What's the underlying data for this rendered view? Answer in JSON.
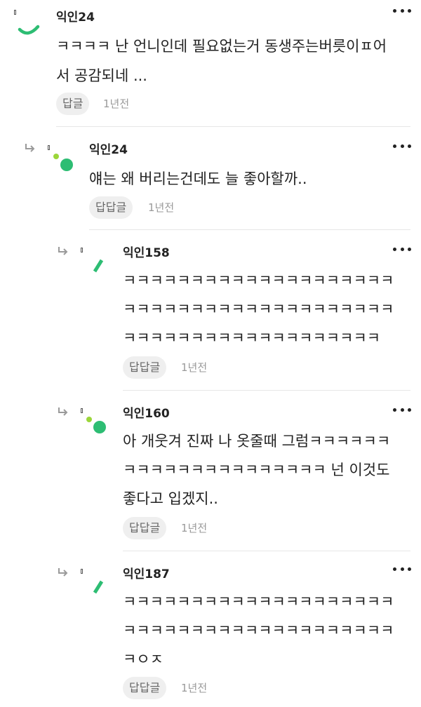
{
  "comments": [
    {
      "author": "익인24",
      "lines": [
        "ㅋㅋㅋㅋ 난 언니인데 필요없는거 동생주는버릇이ㅍ어",
        "서 공감되네 ..."
      ],
      "reply_label": "답글",
      "time": "1년전",
      "avatar_icon": "arc-avatar-icon"
    },
    {
      "author": "익인24",
      "lines": [
        "얘는 왜 버리는건데도 늘 좋아할까.."
      ],
      "reply_label": "답답글",
      "time": "1년전",
      "avatar_icon": "dots-avatar-icon"
    },
    {
      "author": "익인158",
      "lines": [
        "ㅋㅋㅋㅋㅋㅋㅋㅋㅋㅋㅋㅋㅋㅋㅋㅋㅋㅋㅋㅋ",
        "ㅋㅋㅋㅋㅋㅋㅋㅋㅋㅋㅋㅋㅋㅋㅋㅋㅋㅋㅋㅋ",
        "ㅋㅋㅋㅋㅋㅋㅋㅋㅋㅋㅋㅋㅋㅋㅋㅋㅋㅋㅋ"
      ],
      "reply_label": "답답글",
      "time": "1년전",
      "avatar_icon": "slash-avatar-icon"
    },
    {
      "author": "익인160",
      "lines": [
        "아 개웃겨 진짜 나 옷줄때 그럼ㅋㅋㅋㅋㅋㅋ",
        "ㅋㅋㅋㅋㅋㅋㅋㅋㅋㅋㅋㅋㅋㅋㅋ 넌 이것도",
        "좋다고 입겠지.."
      ],
      "reply_label": "답답글",
      "time": "1년전",
      "avatar_icon": "dots-avatar-icon"
    },
    {
      "author": "익인187",
      "lines": [
        "ㅋㅋㅋㅋㅋㅋㅋㅋㅋㅋㅋㅋㅋㅋㅋㅋㅋㅋㅋㅋ",
        "ㅋㅋㅋㅋㅋㅋㅋㅋㅋㅋㅋㅋㅋㅋㅋㅋㅋㅋㅋㅋ",
        "ㅋㅇㅈ"
      ],
      "reply_label": "답답글",
      "time": "1년전",
      "avatar_icon": "slash-avatar-icon"
    }
  ],
  "colors": {
    "accent_green": "#2dbd73",
    "light_green": "#9bd63a",
    "text": "#222222",
    "muted": "#9a9a9a",
    "pill_bg": "#efefef"
  }
}
